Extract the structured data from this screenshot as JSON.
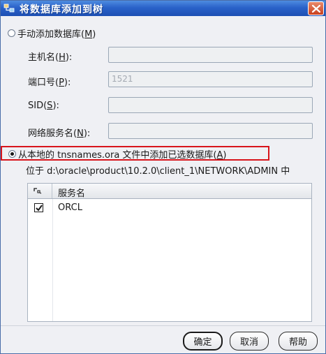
{
  "window": {
    "title": "将数据库添加到树"
  },
  "manual_option": {
    "label_prefix": "手动添加数据库(",
    "mnemonic": "M",
    "label_suffix": ")"
  },
  "fields": {
    "hostname": {
      "prefix": "主机名(",
      "mnemonic": "H",
      "suffix": "):",
      "value": ""
    },
    "port": {
      "prefix": "端口号(",
      "mnemonic": "P",
      "suffix": "):",
      "value": "1521"
    },
    "sid": {
      "prefix": "SID(",
      "mnemonic": "S",
      "suffix": "):",
      "value": ""
    },
    "service": {
      "prefix": "网络服务名(",
      "mnemonic": "N",
      "suffix": "):",
      "value": ""
    }
  },
  "tns_option": {
    "label_prefix": "从本地的 tnsnames.ora 文件中添加已选数据库(",
    "mnemonic": "A",
    "label_suffix": ")",
    "location": "位于 d:\\oracle\\product\\10.2.0\\client_1\\NETWORK\\ADMIN 中"
  },
  "table": {
    "column_header": "服务名",
    "rows": [
      {
        "name": "ORCL",
        "checked": true
      }
    ]
  },
  "buttons": {
    "ok": "确定",
    "cancel": "取消",
    "help": "帮助"
  },
  "colors": {
    "title_bar": "#2a62c9",
    "highlight": "#d8141b",
    "close_button": "#c9401d"
  }
}
